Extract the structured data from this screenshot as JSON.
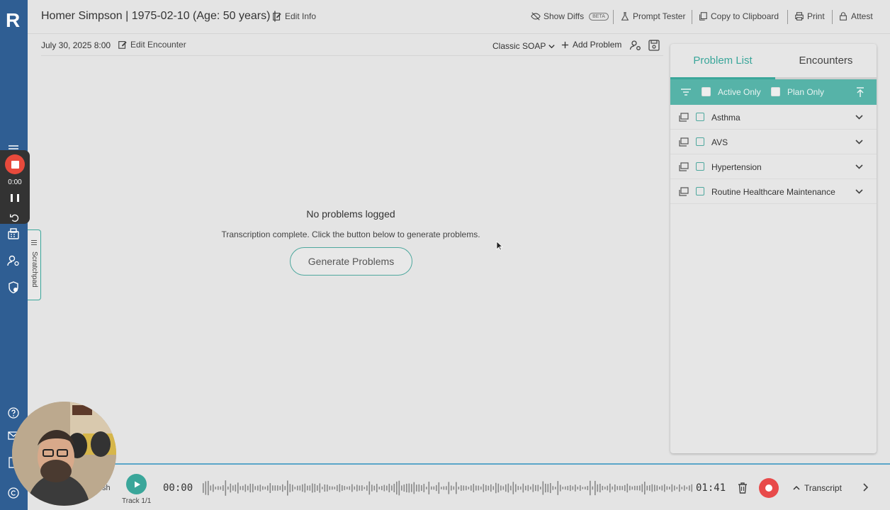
{
  "app": {
    "logo_letter": "R"
  },
  "header": {
    "patient_title": "Homer Simpson | 1975-02-10 (Age: 50 years) |",
    "edit_info_label": "Edit Info",
    "show_diffs_label": "Show Diffs",
    "beta_badge": "BETA",
    "prompt_tester_label": "Prompt Tester",
    "copy_label": "Copy to Clipboard",
    "print_label": "Print",
    "attest_label": "Attest"
  },
  "encounter": {
    "date": "July 30, 2025 8:00",
    "edit_label": "Edit Encounter",
    "template_value": "Classic SOAP",
    "add_problem_label": "Add Problem"
  },
  "recorder": {
    "time": "0:00"
  },
  "scratchpad": {
    "label": "Scratchpad"
  },
  "empty_state": {
    "title": "No problems logged",
    "description": "Transcription complete. Click the button below to generate problems.",
    "button_label": "Generate Problems"
  },
  "panel": {
    "tabs": [
      {
        "label": "Problem List",
        "active": true
      },
      {
        "label": "Encounters",
        "active": false
      }
    ],
    "filters": {
      "active_only_label": "Active Only",
      "plan_only_label": "Plan Only"
    },
    "problems": [
      {
        "name": "Asthma"
      },
      {
        "name": "AVS"
      },
      {
        "name": "Hypertension"
      },
      {
        "name": "Routine Healthcare Maintenance"
      }
    ]
  },
  "audio": {
    "partial_label": "sh",
    "track_label": "Track 1/1",
    "time_start": "00:00",
    "time_end": "01:41",
    "transcript_label": "Transcript"
  },
  "colors": {
    "rail": "#2f5e93",
    "accent": "#3aa69a",
    "filter_bar": "#56b3a8",
    "record": "#e84a4a"
  }
}
